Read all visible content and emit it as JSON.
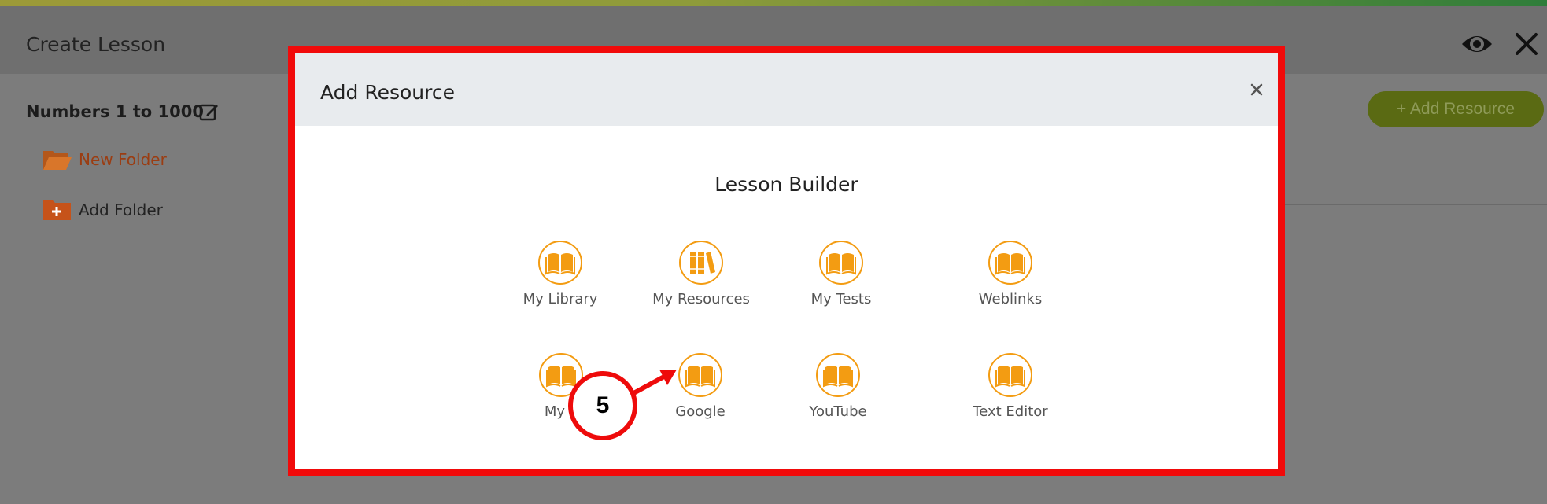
{
  "app": {
    "title": "Create Lesson",
    "lesson_name": "Numbers 1 to 1000",
    "folders": [
      {
        "label": "New Folder",
        "icon": "folder-open-icon"
      },
      {
        "label": "Add Folder",
        "icon": "folder-plus-icon"
      }
    ],
    "add_resource_label": "+ Add Resource",
    "header_icons": [
      "eye-icon",
      "close-icon"
    ]
  },
  "modal": {
    "title": "Add Resource",
    "section_title": "Lesson Builder",
    "tiles": [
      {
        "label": "My Library",
        "icon": "book-icon"
      },
      {
        "label": "My Resources",
        "icon": "books-icon"
      },
      {
        "label": "My Tests",
        "icon": "book-icon"
      },
      {
        "label": "Weblinks",
        "icon": "book-icon"
      },
      {
        "label": "My F",
        "icon": "book-icon"
      },
      {
        "label": "Google",
        "icon": "book-icon"
      },
      {
        "label": "YouTube",
        "icon": "book-icon"
      },
      {
        "label": "Text Editor",
        "icon": "book-icon"
      }
    ]
  },
  "annotation": {
    "step": "5"
  },
  "colors": {
    "accent_orange": "#f39c12",
    "annotation_red": "#ee0b0b",
    "add_button_green": "#5a6a13",
    "folder_orange": "#e07b22"
  }
}
